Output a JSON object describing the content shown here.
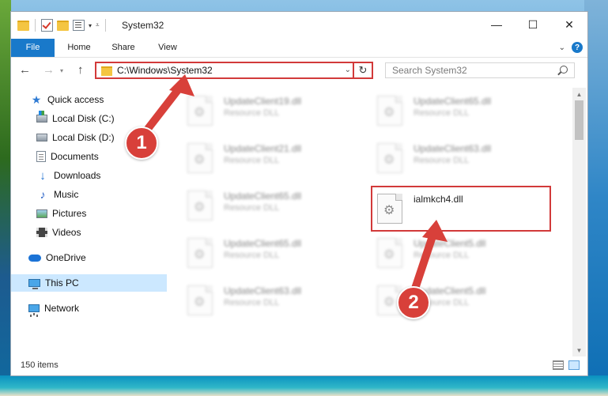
{
  "window": {
    "title": "System32",
    "controls": {
      "minimize": "—",
      "maximize": "☐",
      "close": "✕"
    }
  },
  "ribbon": {
    "tabs": [
      "File",
      "Home",
      "Share",
      "View"
    ],
    "help": "?"
  },
  "nav": {
    "address": "C:\\Windows\\System32",
    "search_placeholder": "Search System32"
  },
  "sidebar": {
    "items": [
      {
        "label": "Quick access",
        "icon": "star-icon",
        "pinned": false
      },
      {
        "label": "Local Disk (C:)",
        "icon": "drive-icon",
        "pinned": true
      },
      {
        "label": "Local Disk (D:)",
        "icon": "drive-icon",
        "pinned": true
      },
      {
        "label": "Documents",
        "icon": "documents-icon",
        "pinned": true
      },
      {
        "label": "Downloads",
        "icon": "download-icon",
        "pinned": true
      },
      {
        "label": "Music",
        "icon": "music-icon",
        "pinned": true
      },
      {
        "label": "Pictures",
        "icon": "pictures-icon",
        "pinned": true
      },
      {
        "label": "Videos",
        "icon": "videos-icon",
        "pinned": true
      },
      {
        "label": "OneDrive",
        "icon": "cloud-icon",
        "pinned": false
      },
      {
        "label": "This PC",
        "icon": "computer-icon",
        "pinned": false,
        "selected": true
      },
      {
        "label": "Network",
        "icon": "network-icon",
        "pinned": false
      }
    ]
  },
  "files": [
    {
      "name": "UpdateClient19.dll",
      "type": "Resource DLL"
    },
    {
      "name": "UpdateClient65.dll",
      "type": "Resource DLL"
    },
    {
      "name": "UpdateClient21.dll",
      "type": "Resource DLL"
    },
    {
      "name": "UpdateClient63.dll",
      "type": "Resource DLL"
    },
    {
      "name": "UpdateClient65.dll",
      "type": "Resource DLL"
    },
    {
      "name": "ialmkch4.dll",
      "type": ""
    },
    {
      "name": "UpdateClient65.dll",
      "type": "Resource DLL"
    },
    {
      "name": "UpdateClient5.dll",
      "type": "Resource DLL"
    },
    {
      "name": "UpdateClient63.dll",
      "type": "Resource DLL"
    },
    {
      "name": "UpdateClient5.dll",
      "type": "Resource DLL"
    }
  ],
  "status": {
    "count": "150 items"
  },
  "annotations": {
    "step1": "1",
    "step2": "2",
    "color": "#d8403a"
  }
}
